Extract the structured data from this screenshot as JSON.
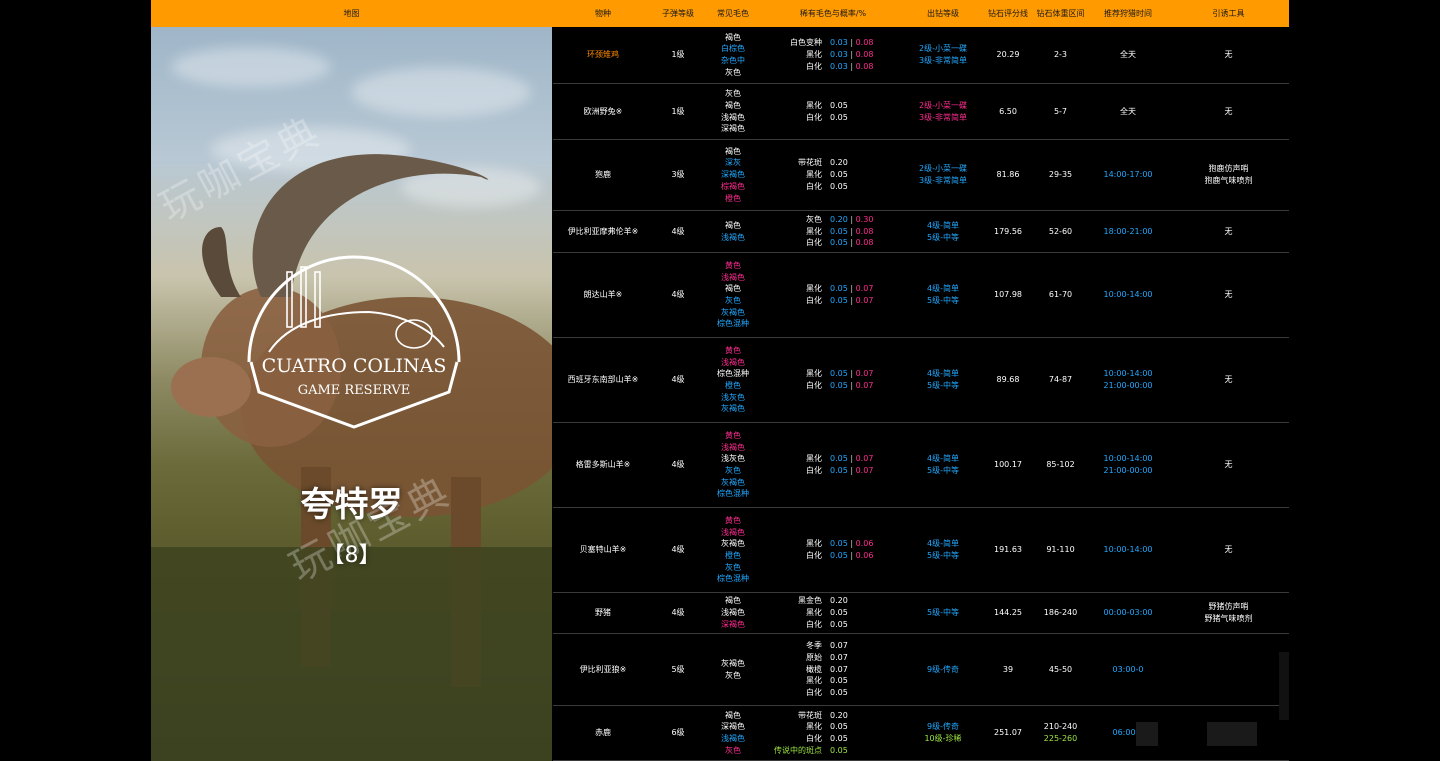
{
  "header": {
    "map": "地图",
    "species": "物种",
    "ammo": "子弹等级",
    "common_fur": "常见毛色",
    "rare_fur": "稀有毛色与概率/%",
    "diamond_level": "出钻等级",
    "diamond_score": "钻石评分线",
    "diamond_weight": "钻石体重区间",
    "hunt_time": "推荐狩猎时间",
    "lure": "引诱工具"
  },
  "map": {
    "logo_line1": "CUATRO COLINAS",
    "logo_line2": "GAME RESERVE",
    "title": "夸特罗",
    "count": "【8】",
    "watermark": "玩咖宝典"
  },
  "colors": {
    "header_bg": "#ff9a00",
    "orange": "#ff8a00",
    "blue": "#22a9ff",
    "pink": "#ff2d8f",
    "green": "#9ee641"
  },
  "rows": [
    {
      "species": {
        "text": "环颈雉鸡",
        "color": "orange"
      },
      "ammo": "1级",
      "common": [
        {
          "t": "褐色",
          "c": "white"
        },
        {
          "t": "白棕色",
          "c": "blue"
        },
        {
          "t": "杂色中",
          "c": "blue"
        },
        {
          "t": "灰色",
          "c": "white"
        }
      ],
      "rare": [
        {
          "name": "白色变种",
          "v1": "0.03",
          "v2": "0.08"
        },
        {
          "name": "黑化",
          "v1": "0.03",
          "v2": "0.08"
        },
        {
          "name": "白化",
          "v1": "0.03",
          "v2": "0.08"
        }
      ],
      "levels": [
        {
          "t": "2级-小菜一碟",
          "c": "blue"
        },
        {
          "t": "3级-非常简单",
          "c": "blue"
        }
      ],
      "score": "20.29",
      "weight": "2-3",
      "time": [
        {
          "t": "全天",
          "c": "white"
        }
      ],
      "lure": [
        "无"
      ]
    },
    {
      "species": {
        "text": "欧洲野兔※",
        "color": "white"
      },
      "ammo": "1级",
      "common": [
        {
          "t": "灰色",
          "c": "white"
        },
        {
          "t": "褐色",
          "c": "white"
        },
        {
          "t": "浅褐色",
          "c": "white"
        },
        {
          "t": "深褐色",
          "c": "white"
        }
      ],
      "rare": [
        {
          "name": "黑化",
          "v1": "0.05",
          "v2": ""
        },
        {
          "name": "白化",
          "v1": "0.05",
          "v2": ""
        }
      ],
      "levels": [
        {
          "t": "2级-小菜一碟",
          "c": "pink"
        },
        {
          "t": "3级-非常简单",
          "c": "pink"
        }
      ],
      "score": "6.50",
      "weight": "5-7",
      "time": [
        {
          "t": "全天",
          "c": "white"
        }
      ],
      "lure": [
        "无"
      ]
    },
    {
      "species": {
        "text": "狍鹿",
        "color": "white"
      },
      "ammo": "3级",
      "common": [
        {
          "t": "褐色",
          "c": "white"
        },
        {
          "t": "深灰",
          "c": "blue"
        },
        {
          "t": "深褐色",
          "c": "blue"
        },
        {
          "t": "棕褐色",
          "c": "pink"
        },
        {
          "t": "橙色",
          "c": "pink"
        }
      ],
      "rare": [
        {
          "name": "带花斑",
          "v1": "0.20",
          "v2": ""
        },
        {
          "name": "黑化",
          "v1": "0.05",
          "v2": ""
        },
        {
          "name": "白化",
          "v1": "0.05",
          "v2": ""
        }
      ],
      "levels": [
        {
          "t": "2级-小菜一碟",
          "c": "blue"
        },
        {
          "t": "3级-非常简单",
          "c": "blue"
        }
      ],
      "score": "81.86",
      "weight": "29-35",
      "time": [
        {
          "t": "14:00-17:00",
          "c": "blue"
        }
      ],
      "lure": [
        "狍鹿仿声哨",
        "狍鹿气味喷剂"
      ]
    },
    {
      "species": {
        "text": "伊比利亚摩弗伦羊※",
        "color": "white"
      },
      "ammo": "4级",
      "common": [
        {
          "t": "褐色",
          "c": "white"
        },
        {
          "t": "浅褐色",
          "c": "blue"
        }
      ],
      "rare": [
        {
          "name": "灰色",
          "v1": "0.20",
          "v2": "0.30"
        },
        {
          "name": "黑化",
          "v1": "0.05",
          "v2": "0.08"
        },
        {
          "name": "白化",
          "v1": "0.05",
          "v2": "0.08"
        }
      ],
      "levels": [
        {
          "t": "4级-简单",
          "c": "blue"
        },
        {
          "t": "5级-中等",
          "c": "blue"
        }
      ],
      "score": "179.56",
      "weight": "52-60",
      "time": [
        {
          "t": "18:00-21:00",
          "c": "blue"
        }
      ],
      "lure": [
        "无"
      ]
    },
    {
      "species": {
        "text": "朗达山羊※",
        "color": "white"
      },
      "ammo": "4级",
      "common": [
        {
          "t": "黄色",
          "c": "pink"
        },
        {
          "t": "浅褐色",
          "c": "pink"
        },
        {
          "t": "褐色",
          "c": "white"
        },
        {
          "t": "灰色",
          "c": "blue"
        },
        {
          "t": "灰褐色",
          "c": "blue"
        },
        {
          "t": "棕色混种",
          "c": "blue"
        }
      ],
      "rare": [
        {
          "name": "黑化",
          "v1": "0.05",
          "v2": "0.07"
        },
        {
          "name": "白化",
          "v1": "0.05",
          "v2": "0.07"
        }
      ],
      "levels": [
        {
          "t": "4级-简单",
          "c": "blue"
        },
        {
          "t": "5级-中等",
          "c": "blue"
        }
      ],
      "score": "107.98",
      "weight": "61-70",
      "time": [
        {
          "t": "10:00-14:00",
          "c": "blue"
        }
      ],
      "lure": [
        "无"
      ]
    },
    {
      "species": {
        "text": "西班牙东南部山羊※",
        "color": "white"
      },
      "ammo": "4级",
      "common": [
        {
          "t": "黄色",
          "c": "pink"
        },
        {
          "t": "浅褐色",
          "c": "pink"
        },
        {
          "t": "棕色混种",
          "c": "white"
        },
        {
          "t": "橙色",
          "c": "blue"
        },
        {
          "t": "浅灰色",
          "c": "blue"
        },
        {
          "t": "灰褐色",
          "c": "blue"
        }
      ],
      "rare": [
        {
          "name": "黑化",
          "v1": "0.05",
          "v2": "0.07"
        },
        {
          "name": "白化",
          "v1": "0.05",
          "v2": "0.07"
        }
      ],
      "levels": [
        {
          "t": "4级-简单",
          "c": "blue"
        },
        {
          "t": "5级-中等",
          "c": "blue"
        }
      ],
      "score": "89.68",
      "weight": "74-87",
      "time": [
        {
          "t": "10:00-14:00",
          "c": "blue"
        },
        {
          "t": "21:00-00:00",
          "c": "blue"
        }
      ],
      "lure": [
        "无"
      ]
    },
    {
      "species": {
        "text": "格雷多斯山羊※",
        "color": "white"
      },
      "ammo": "4级",
      "common": [
        {
          "t": "黄色",
          "c": "pink"
        },
        {
          "t": "浅褐色",
          "c": "pink"
        },
        {
          "t": "浅灰色",
          "c": "white"
        },
        {
          "t": "灰色",
          "c": "blue"
        },
        {
          "t": "灰褐色",
          "c": "blue"
        },
        {
          "t": "棕色混种",
          "c": "blue"
        }
      ],
      "rare": [
        {
          "name": "黑化",
          "v1": "0.05",
          "v2": "0.07"
        },
        {
          "name": "白化",
          "v1": "0.05",
          "v2": "0.07"
        }
      ],
      "levels": [
        {
          "t": "4级-简单",
          "c": "blue"
        },
        {
          "t": "5级-中等",
          "c": "blue"
        }
      ],
      "score": "100.17",
      "weight": "85-102",
      "time": [
        {
          "t": "10:00-14:00",
          "c": "blue"
        },
        {
          "t": "21:00-00:00",
          "c": "blue"
        }
      ],
      "lure": [
        "无"
      ]
    },
    {
      "species": {
        "text": "贝塞特山羊※",
        "color": "white"
      },
      "ammo": "4级",
      "common": [
        {
          "t": "黄色",
          "c": "pink"
        },
        {
          "t": "浅褐色",
          "c": "pink"
        },
        {
          "t": "灰褐色",
          "c": "white"
        },
        {
          "t": "橙色",
          "c": "blue"
        },
        {
          "t": "灰色",
          "c": "blue"
        },
        {
          "t": "棕色混种",
          "c": "blue"
        }
      ],
      "rare": [
        {
          "name": "黑化",
          "v1": "0.05",
          "v2": "0.06"
        },
        {
          "name": "白化",
          "v1": "0.05",
          "v2": "0.06"
        }
      ],
      "levels": [
        {
          "t": "4级-简单",
          "c": "blue"
        },
        {
          "t": "5级-中等",
          "c": "blue"
        }
      ],
      "score": "191.63",
      "weight": "91-110",
      "time": [
        {
          "t": "10:00-14:00",
          "c": "blue"
        }
      ],
      "lure": [
        "无"
      ]
    },
    {
      "species": {
        "text": "野猪",
        "color": "white"
      },
      "ammo": "4级",
      "common": [
        {
          "t": "褐色",
          "c": "white"
        },
        {
          "t": "浅褐色",
          "c": "white"
        },
        {
          "t": "深褐色",
          "c": "pink"
        }
      ],
      "rare": [
        {
          "name": "黑金色",
          "v1": "0.20",
          "v2": ""
        },
        {
          "name": "黑化",
          "v1": "0.05",
          "v2": ""
        },
        {
          "name": "白化",
          "v1": "0.05",
          "v2": ""
        }
      ],
      "levels": [
        {
          "t": "5级-中等",
          "c": "blue"
        }
      ],
      "score": "144.25",
      "weight": "186-240",
      "time": [
        {
          "t": "00:00-03:00",
          "c": "blue"
        }
      ],
      "lure": [
        "野猪仿声哨",
        "野猪气味喷剂"
      ]
    },
    {
      "species": {
        "text": "伊比利亚狼※",
        "color": "white"
      },
      "ammo": "5级",
      "common": [
        {
          "t": "灰褐色",
          "c": "white"
        },
        {
          "t": "灰色",
          "c": "white"
        }
      ],
      "rare": [
        {
          "name": "冬季",
          "v1": "0.07",
          "v2": ""
        },
        {
          "name": "原始",
          "v1": "0.07",
          "v2": ""
        },
        {
          "name": "橄榄",
          "v1": "0.07",
          "v2": ""
        },
        {
          "name": "黑化",
          "v1": "0.05",
          "v2": ""
        },
        {
          "name": "白化",
          "v1": "0.05",
          "v2": ""
        }
      ],
      "levels": [
        {
          "t": "9级-传奇",
          "c": "blue"
        }
      ],
      "score": "39",
      "weight": "45-50",
      "time": [
        {
          "t": "03:00-0",
          "c": "blue"
        }
      ],
      "lure": []
    },
    {
      "species": {
        "text": "赤鹿",
        "color": "white"
      },
      "ammo": "6级",
      "common": [
        {
          "t": "褐色",
          "c": "white"
        },
        {
          "t": "深褐色",
          "c": "white"
        },
        {
          "t": "浅褐色",
          "c": "blue"
        },
        {
          "t": "灰色",
          "c": "pink"
        }
      ],
      "rare": [
        {
          "name": "带花斑",
          "v1": "0.20",
          "v2": "",
          "nc": "white",
          "vc": "white"
        },
        {
          "name": "黑化",
          "v1": "0.05",
          "v2": "",
          "nc": "white",
          "vc": "white"
        },
        {
          "name": "白化",
          "v1": "0.05",
          "v2": "",
          "nc": "white",
          "vc": "white"
        },
        {
          "name": "传说中的斑点",
          "v1": "0.05",
          "v2": "",
          "nc": "green",
          "vc": "green"
        }
      ],
      "levels": [
        {
          "t": "9级-传奇",
          "c": "blue"
        },
        {
          "t": "10级-珍稀",
          "c": "green"
        }
      ],
      "score": "251.07",
      "weight2": [
        {
          "t": "210-240",
          "c": "white"
        },
        {
          "t": "225-260",
          "c": "green"
        }
      ],
      "time": [
        {
          "t": "06:00-1",
          "c": "blue"
        }
      ],
      "lure": []
    }
  ]
}
